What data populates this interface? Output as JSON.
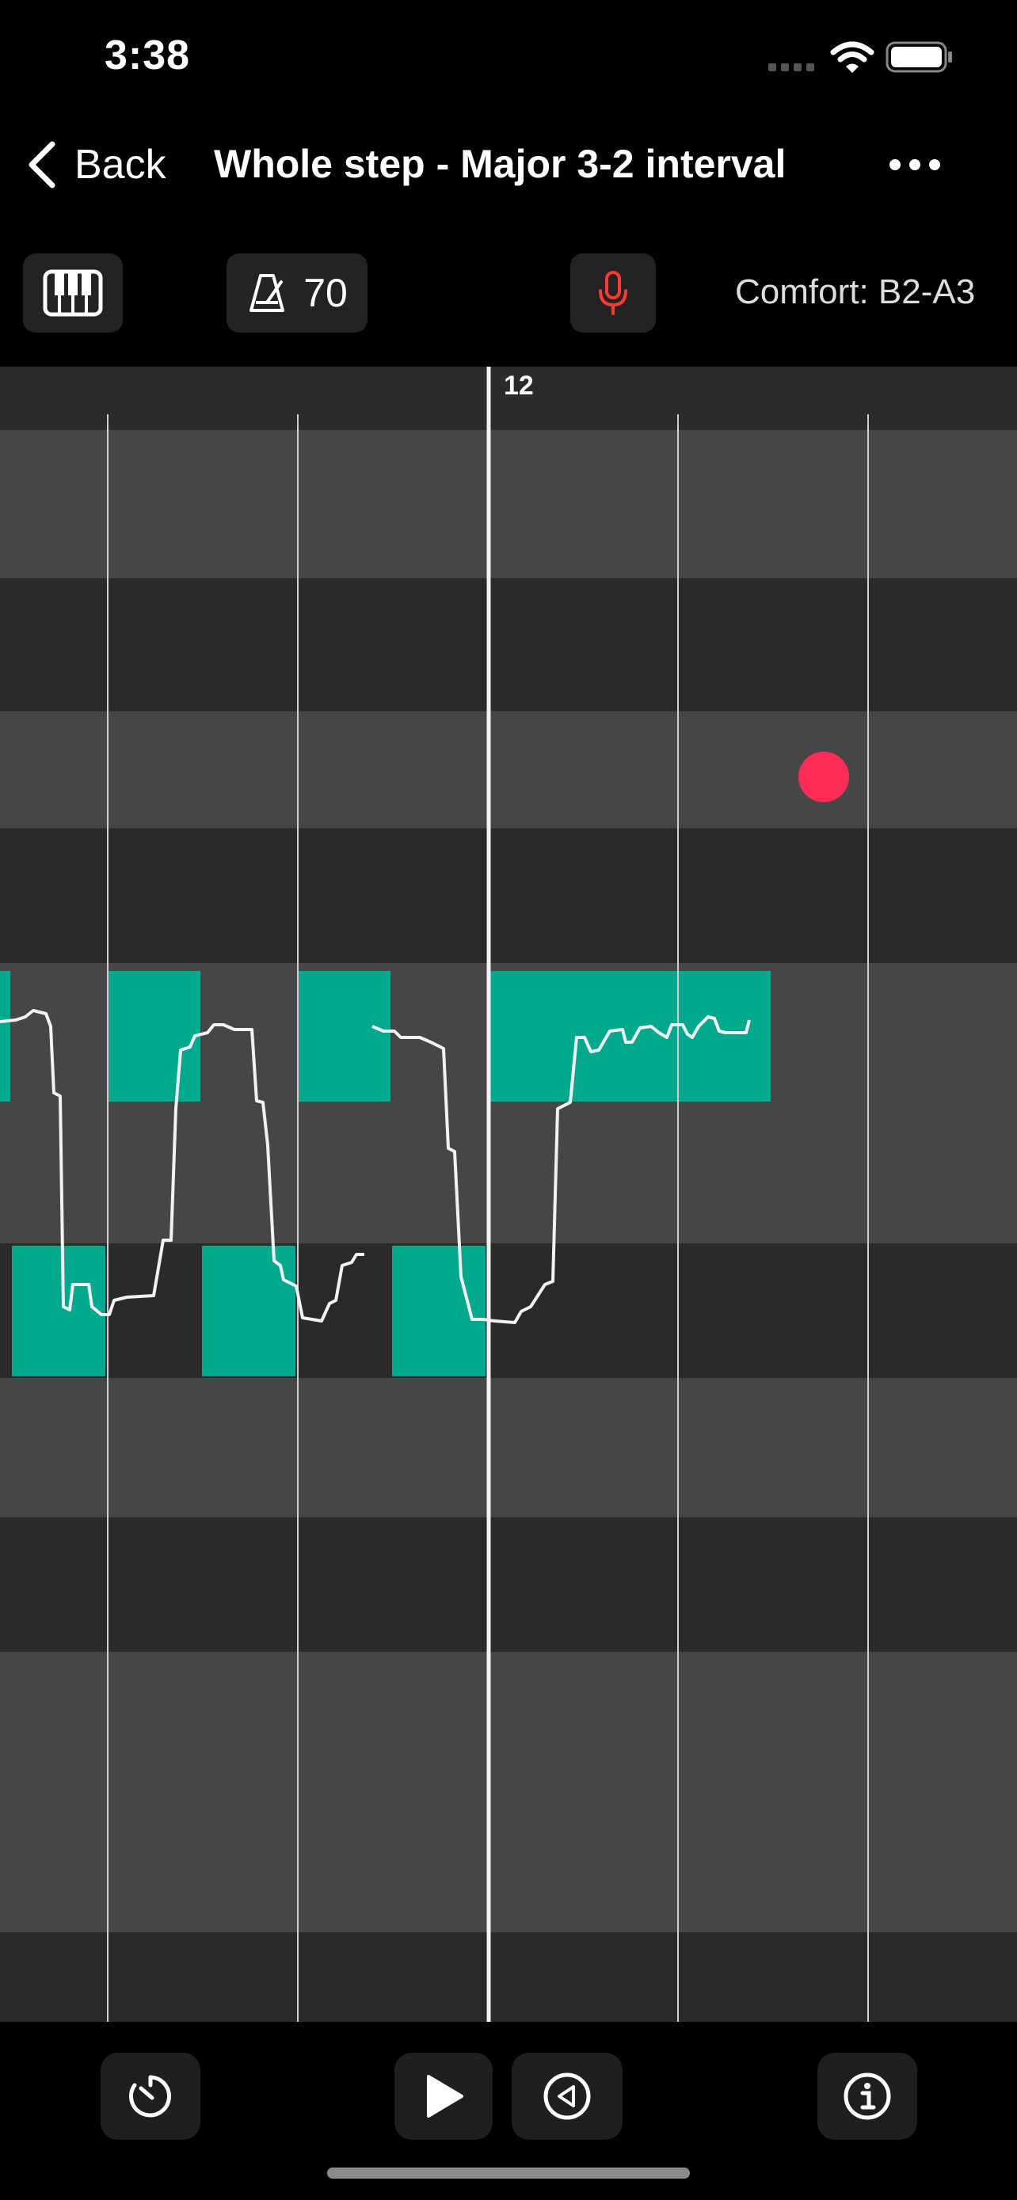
{
  "status": {
    "time": "3:38"
  },
  "nav": {
    "back_label": "Back",
    "title": "Whole step - Major 3-2 interval"
  },
  "toolbar": {
    "tempo": "70",
    "comfort": "Comfort: B2-A3"
  },
  "editor": {
    "measure": "12"
  },
  "colors": {
    "note": "#00a88e",
    "row_light": "#464646",
    "row_dark": "#2a2a2a",
    "ruler": "#2b2b2b",
    "record_dot": "#ff2d55",
    "mic": "#ff3b30"
  },
  "icons": [
    "signal-icon",
    "wifi-icon",
    "battery-icon",
    "chevron-left-icon",
    "ellipsis-icon",
    "piano-icon",
    "metronome-icon",
    "microphone-icon",
    "timer-icon",
    "play-icon",
    "rewind-icon",
    "info-icon"
  ]
}
